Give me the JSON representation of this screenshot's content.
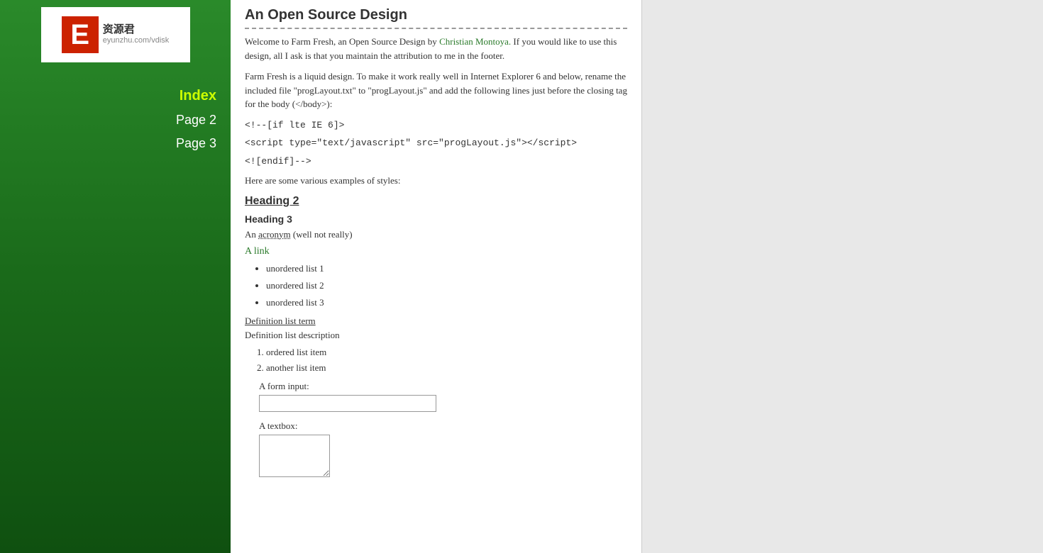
{
  "logo": {
    "letter": "E",
    "line1": "资源君",
    "line2": "eyunzhu.com/vdisk"
  },
  "nav": {
    "items": [
      {
        "label": "Index",
        "active": true,
        "href": "#"
      },
      {
        "label": "Page 2",
        "active": false,
        "href": "#"
      },
      {
        "label": "Page 3",
        "active": false,
        "href": "#"
      }
    ]
  },
  "content": {
    "title": "An Open Source Design",
    "intro1": "Welcome to Farm Fresh, an Open Source Design by ",
    "author_link": "Christian Montoya.",
    "intro2": " If you would like to use this design, all I ask is that you maintain the attribution to me in the footer.",
    "para1": "Farm Fresh is a liquid design. To make it work really well in Internet Explorer 6 and below, rename the included file \"progLayout.txt\" to \"progLayout.js\" and add the following lines just before the closing tag for the body (</body>):",
    "code1": "<!--[if lte IE 6]>",
    "code2": "<script type=\"text/javascript\" src=\"progLayout.js\"><\\/script>",
    "code3": "<![endif]-->",
    "examples_intro": "Here are some various examples of styles:",
    "heading2": "Heading 2",
    "heading3": "Heading 3",
    "acronym_pre": "An ",
    "acronym": "acronym",
    "acronym_post": " (well not really)",
    "link": "A link",
    "ul_items": [
      "unordered list 1",
      "unordered list 2",
      "unordered list 3"
    ],
    "dl_term": "Definition list term",
    "dl_desc": "Definition list description",
    "ol_items": [
      "ordered list item",
      "another list item"
    ],
    "form_input_label": "A form input:",
    "form_textarea_label": "A textbox:"
  }
}
